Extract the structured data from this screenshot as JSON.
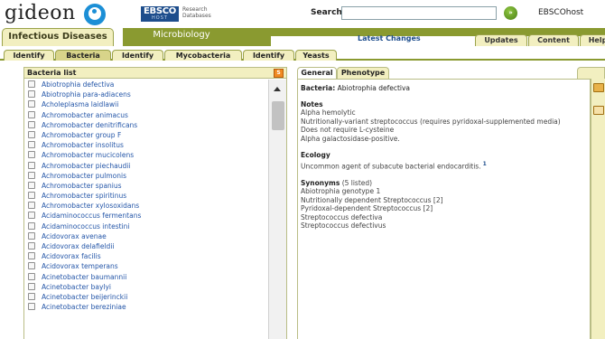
{
  "header": {
    "logo_text": "gideon",
    "ebsco_logo_text": "EBSCO",
    "ebsco_logo_sub": "HOST",
    "ebsco_caption_line1": "Research",
    "ebsco_caption_line2": "Databases",
    "search_label": "Search",
    "search_value": "",
    "search_go_label": "»",
    "ebscohost_link": "EBSCOhost"
  },
  "top_nav": {
    "infectious_diseases_tab": "Infectious Diseases",
    "microbiology_tab": "Microbiology",
    "latest_changes": "Latest Changes",
    "tabs": [
      "Updates",
      "Content",
      "Help"
    ]
  },
  "sub_nav": {
    "tabs": [
      "Identify",
      "Bacteria",
      "Identify",
      "Mycobacteria",
      "Identify",
      "Yeasts"
    ],
    "active_index": 1
  },
  "left_panel": {
    "title": "Bacteria list",
    "sort_label": "S",
    "items": [
      "Abiotrophia defectiva",
      "Abiotrophia para-adiacens",
      "Acholeplasma laidlawii",
      "Achromobacter animacus",
      "Achromobacter denitrificans",
      "Achromobacter group F",
      "Achromobacter insolitus",
      "Achromobacter mucicolens",
      "Achromobacter piechaudii",
      "Achromobacter pulmonis",
      "Achromobacter spanius",
      "Achromobacter spiritinus",
      "Achromobacter xylosoxidans",
      "Acidaminococcus fermentans",
      "Acidaminococcus intestini",
      "Acidovorax avenae",
      "Acidovorax delafieldii",
      "Acidovorax facilis",
      "Acidovorax temperans",
      "Acinetobacter baumannii",
      "Acinetobacter baylyi",
      "Acinetobacter beijerinckii",
      "Acinetobacter bereziniae"
    ]
  },
  "right_panel": {
    "tabs": [
      "General",
      "Phenotype"
    ],
    "active_tab": "Phenotype",
    "bacteria_label": "Bacteria:",
    "bacteria_value": "Abiotrophia defectiva",
    "notes_title": "Notes",
    "notes": [
      "Alpha hemolytic",
      "Nutritionally-variant streptococcus (requires pyridoxal-supplemented media)",
      "Does not require L-cysteine",
      "Alpha galactosidase-positive."
    ],
    "ecology_title": "Ecology",
    "ecology_text": "Uncommon agent of subacute bacterial endocarditis.",
    "ecology_ref": "1",
    "synonyms_title": "Synonyms",
    "synonyms_count": "(5 listed)",
    "synonyms": [
      "Abiotrophia genotype 1",
      "Nutritionally dependent Streptococcus [2]",
      "Pyridoxal-dependent Streptococcus [2]",
      "Streptococcus defectiva",
      "Streptococcus defectivus"
    ]
  }
}
